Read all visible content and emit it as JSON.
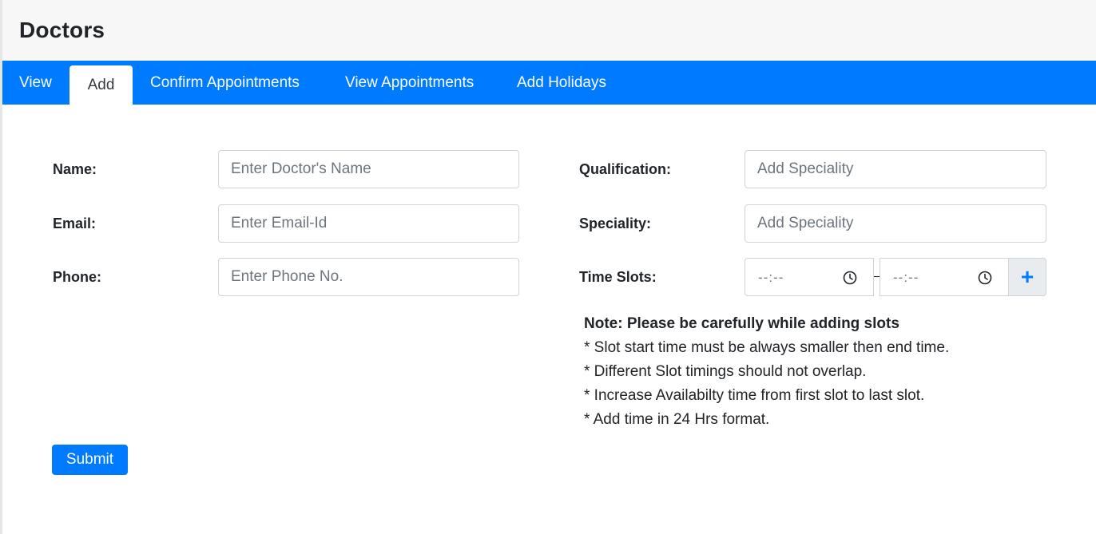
{
  "header": {
    "title": "Doctors"
  },
  "tabs": [
    {
      "label": "View",
      "active": false
    },
    {
      "label": "Add",
      "active": true
    },
    {
      "label": "Confirm Appointments",
      "active": false
    },
    {
      "label": "View Appointments",
      "active": false
    },
    {
      "label": "Add Holidays",
      "active": false
    }
  ],
  "form": {
    "name": {
      "label": "Name:",
      "placeholder": "Enter Doctor's Name",
      "value": ""
    },
    "email": {
      "label": "Email:",
      "placeholder": "Enter Email-Id",
      "value": ""
    },
    "phone": {
      "label": "Phone:",
      "placeholder": "Enter Phone No.",
      "value": ""
    },
    "qualification": {
      "label": "Qualification:",
      "placeholder": "Add Speciality",
      "value": ""
    },
    "speciality": {
      "label": "Speciality:",
      "placeholder": "Add Speciality",
      "value": ""
    },
    "time_slots": {
      "label": "Time Slots:",
      "start_value": "--:--",
      "end_value": "--:--",
      "separator": "-",
      "add_icon": "plus-icon",
      "add_label": "+"
    }
  },
  "note": {
    "heading_bold": "Note:",
    "heading_text": " Please be carefully while adding slots",
    "lines": [
      "* Slot start time must be always smaller then end time.",
      "* Different Slot timings should not overlap.",
      "* Increase Availabilty time from first slot to last slot.",
      "* Add time in 24 Hrs format."
    ]
  },
  "submit": {
    "label": "Submit"
  },
  "colors": {
    "primary": "#007bff",
    "header_bg": "#f7f7f7",
    "border": "#ced4da"
  }
}
